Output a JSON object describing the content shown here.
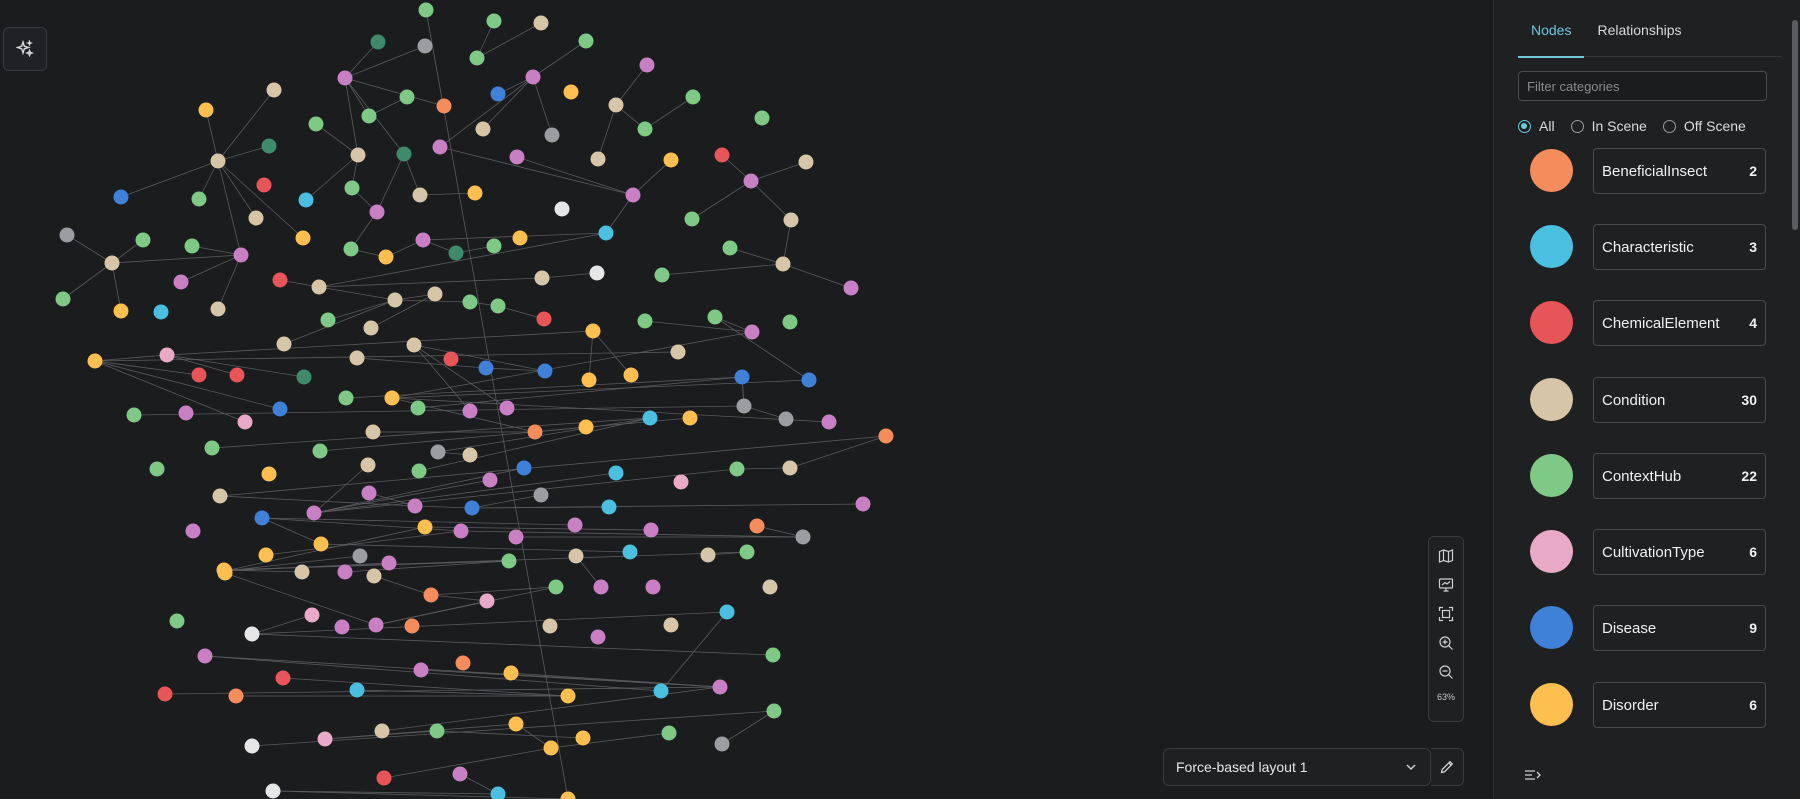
{
  "panel": {
    "tabs": [
      {
        "label": "Nodes",
        "active": true
      },
      {
        "label": "Relationships",
        "active": false
      }
    ],
    "filter_placeholder": "Filter categories",
    "scope_options": [
      {
        "label": "All",
        "checked": true
      },
      {
        "label": "In Scene",
        "checked": false
      },
      {
        "label": "Off Scene",
        "checked": false
      }
    ],
    "categories": [
      {
        "name": "BeneficialInsect",
        "count": "2",
        "color": "#f48c5c"
      },
      {
        "name": "Characteristic",
        "count": "3",
        "color": "#4bbfe0"
      },
      {
        "name": "ChemicalElement",
        "count": "4",
        "color": "#e85558"
      },
      {
        "name": "Condition",
        "count": "30",
        "color": "#d6c5a6"
      },
      {
        "name": "ContextHub",
        "count": "22",
        "color": "#7dc985"
      },
      {
        "name": "CultivationType",
        "count": "6",
        "color": "#e8aac6"
      },
      {
        "name": "Disease",
        "count": "9",
        "color": "#3f80d8"
      },
      {
        "name": "Disorder",
        "count": "6",
        "color": "#fdbf4f"
      }
    ]
  },
  "toolbar": {
    "zoom_level": "63%",
    "icons": [
      "map-icon",
      "presentation-icon",
      "fit-screen-icon",
      "zoom-in-icon",
      "zoom-out-icon"
    ]
  },
  "layout": {
    "selected": "Force-based layout 1"
  },
  "graph": {
    "palette": {
      "orange": "#f48c5c",
      "cyan": "#4bbfe0",
      "red": "#e85558",
      "tan": "#d6c5a6",
      "green": "#7dc985",
      "pink": "#e8aac6",
      "blue": "#3f80d8",
      "yellow": "#fdbf4f",
      "purple": "#c97fc4",
      "gray": "#9c9ca3",
      "darkgreen": "#3e8a6a",
      "white": "#e6e6e6",
      "lightyellow": "#ffd66b"
    }
  }
}
